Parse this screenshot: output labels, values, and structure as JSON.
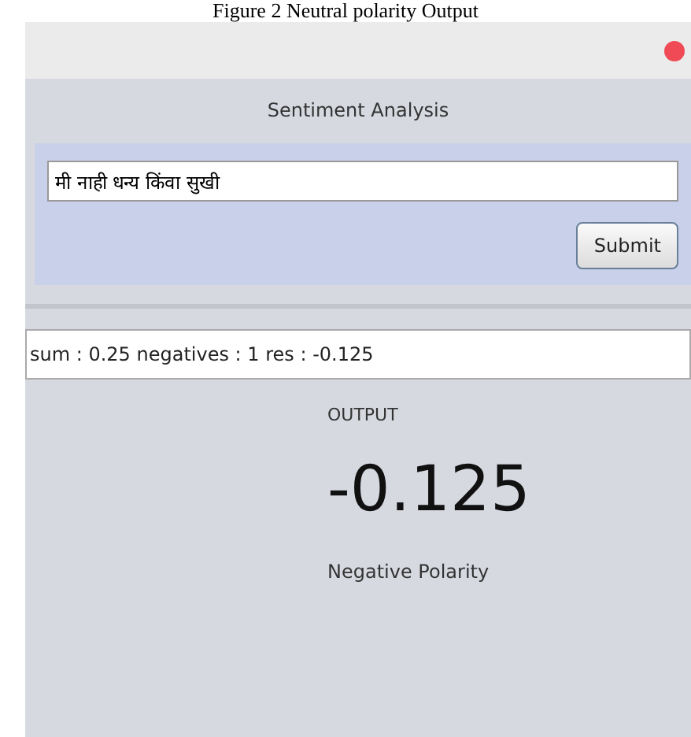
{
  "caption": "Figure 2 Neutral polarity Output",
  "window": {
    "title": "Sentiment Analysis"
  },
  "input": {
    "value": "मी नाही धन्य किंवा सुखी"
  },
  "submit_button": "Submit",
  "result_field": {
    "value": "sum : 0.25 negatives : 1 res : -0.125"
  },
  "output": {
    "label": "OUTPUT",
    "score": "-0.125",
    "polarity": "Negative Polarity"
  }
}
